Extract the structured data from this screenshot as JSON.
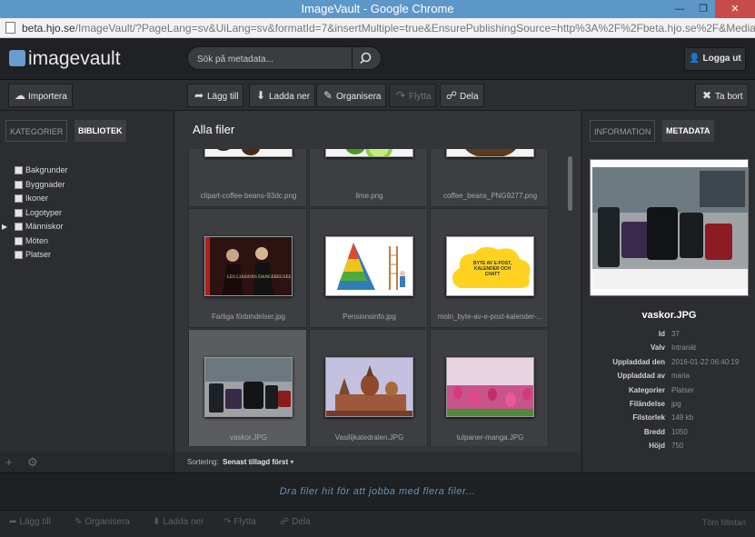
{
  "browser": {
    "window_title": "ImageVault - Google Chrome",
    "url_host": "beta.hjo.se",
    "url_rest": "/ImageVault/?PageLang=sv&UiLang=sv&formatId=7&insertMultiple=true&EnsurePublishingSource=http%3A%2F%2Fbeta.hjo.se%2F&MediaUrlBase"
  },
  "header": {
    "logo_text": "imagevault",
    "search_placeholder": "Sök på metadata...",
    "login_label": "Logga ut"
  },
  "toolbar": {
    "import_label": "Importera",
    "add_label": "Lägg till",
    "download_label": "Ladda ner",
    "organize_label": "Organisera",
    "move_label": "Flytta",
    "share_label": "Dela",
    "delete_label": "Ta bort"
  },
  "left": {
    "tab_categories": "KATEGORIER",
    "tab_library": "BIBLIOTEK",
    "categories": [
      "Bakgrunder",
      "Byggnader",
      "Ikoner",
      "Logotyper",
      "Människor",
      "Möten",
      "Platser"
    ]
  },
  "main": {
    "title": "Alla filer",
    "files": [
      {
        "name": "clipart-coffee-beans-93dc.png"
      },
      {
        "name": "lime.png"
      },
      {
        "name": "coffee_beans_PNG9277.png"
      },
      {
        "name": "Farliga förbindelser.jpg"
      },
      {
        "name": "Pensionsinfo.jpg"
      },
      {
        "name": "moln_byte-av-e-post-kalender-..."
      },
      {
        "name": "vaskor.JPG"
      },
      {
        "name": "Vasilijkatedralen.JPG"
      },
      {
        "name": "tulpaner-manga.JPG"
      }
    ],
    "movie_title": "LES LIAISONS DANGEREUSES",
    "pyramid_text": "",
    "cloud_text": "BYTE AV E-POST, KALENDER OCH CHATT",
    "sort_label": "Sortering",
    "sort_value": "Senast tillagd först"
  },
  "right": {
    "tab_information": "INFORMATION",
    "tab_metadata": "METADATA",
    "file_title": "vaskor.JPG",
    "fields": [
      {
        "key": "Id",
        "value": "37"
      },
      {
        "key": "Valv",
        "value": "Intranät"
      },
      {
        "key": "Uppladdad den",
        "value": "2016-01-22 06:40:19"
      },
      {
        "key": "Uppladdad av",
        "value": "maria"
      },
      {
        "key": "Kategorier",
        "value": "Platser"
      },
      {
        "key": "Filändelse",
        "value": "jpg"
      },
      {
        "key": "Filstorlek",
        "value": "149 kb"
      },
      {
        "key": "Bredd",
        "value": "1050"
      },
      {
        "key": "Höjd",
        "value": "750"
      }
    ]
  },
  "dropzone": {
    "text": "Dra filer hit för att jobba med flera filer..."
  },
  "bottombar": {
    "add_label": "Lägg till",
    "organize_label": "Organisera",
    "download_label": "Ladda ner",
    "move_label": "Flytta",
    "share_label": "Dela",
    "clear_label": "Töm fillistan"
  },
  "colors": {
    "accent": "#5d97c8",
    "panel_dark": "#2b2d30",
    "drop_text": "#6a8fb5"
  }
}
